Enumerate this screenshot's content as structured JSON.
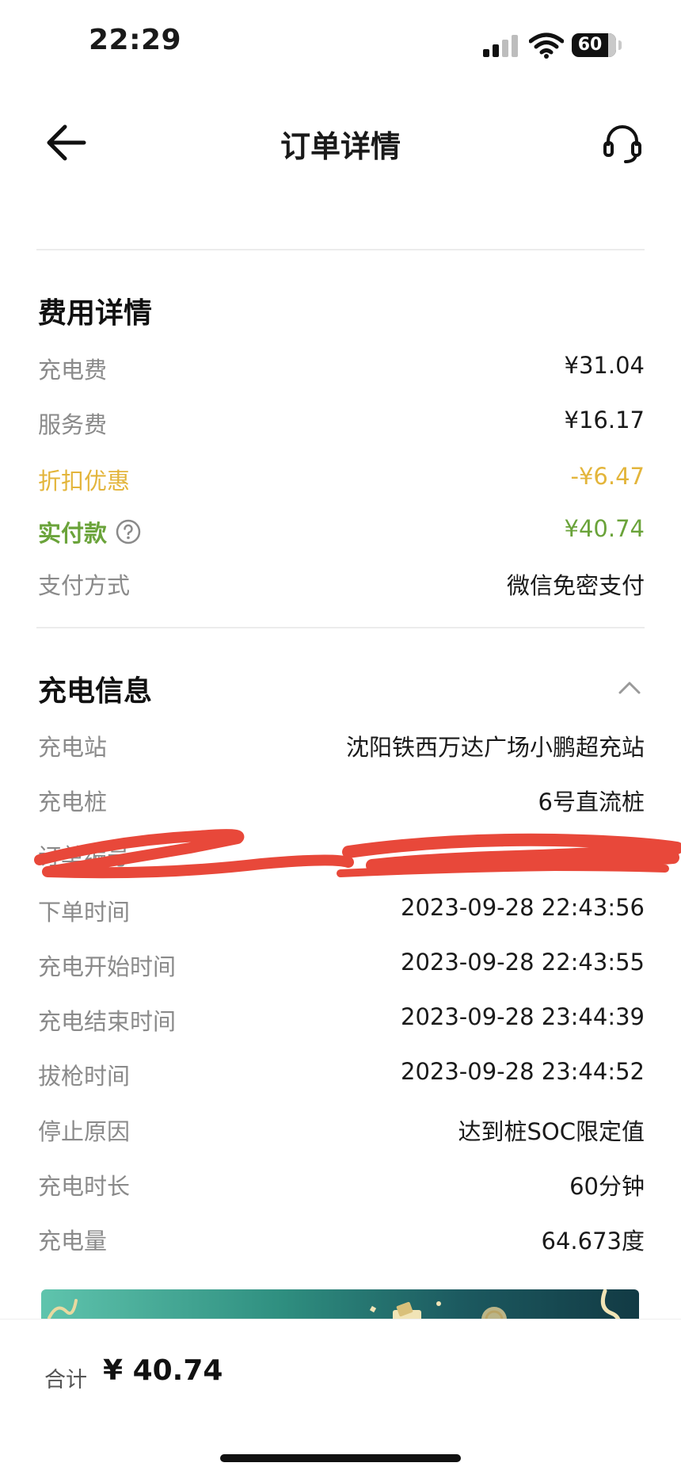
{
  "status_bar": {
    "time": "22:29",
    "battery": "60"
  },
  "nav": {
    "title": "订单详情"
  },
  "fee_section": {
    "title": "费用详情",
    "rows": [
      {
        "label": "充电费",
        "value": "¥31.04"
      },
      {
        "label": "服务费",
        "value": "¥16.17"
      },
      {
        "label": "折扣优惠",
        "value": "-¥6.47"
      },
      {
        "label": "实付款",
        "value": "¥40.74"
      },
      {
        "label": "支付方式",
        "value": "微信免密支付"
      }
    ]
  },
  "charge_section": {
    "title": "充电信息",
    "rows": [
      {
        "label": "充电站",
        "value": "沈阳铁西万达广场小鹏超充站"
      },
      {
        "label": "充电桩",
        "value": "6号直流桩"
      },
      {
        "label": "订单编号",
        "value": ""
      },
      {
        "label": "下单时间",
        "value": "2023-09-28 22:43:56"
      },
      {
        "label": "充电开始时间",
        "value": "2023-09-28 22:43:55"
      },
      {
        "label": "充电结束时间",
        "value": "2023-09-28 23:44:39"
      },
      {
        "label": "拔枪时间",
        "value": "2023-09-28 23:44:52"
      },
      {
        "label": "停止原因",
        "value": "达到桩SOC限定值"
      },
      {
        "label": "充电时长",
        "value": "60分钟"
      },
      {
        "label": "充电量",
        "value": "64.673度"
      }
    ]
  },
  "footer": {
    "total_label": "合计",
    "total_value": "¥ 40.74"
  },
  "colors": {
    "discount": "#e3b53b",
    "paid": "#6aa33a",
    "label_gray": "#8a8a8a",
    "redaction": "#e8483a"
  },
  "icons": [
    "back-arrow-icon",
    "headset-icon",
    "help-icon",
    "chevron-up-icon",
    "signal-icon",
    "wifi-icon",
    "battery-icon"
  ]
}
